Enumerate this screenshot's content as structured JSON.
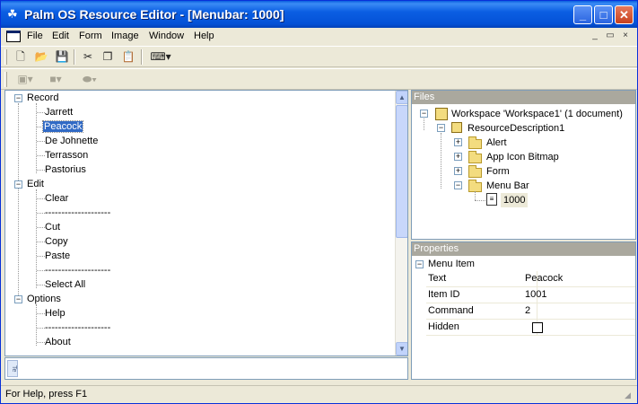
{
  "window": {
    "title": "Palm OS Resource Editor - [Menubar: 1000]",
    "minimize": "_",
    "maximize": "□",
    "close": "✕"
  },
  "menubar": {
    "items": [
      "File",
      "Edit",
      "Form",
      "Image",
      "Window",
      "Help"
    ],
    "mdi": [
      "_",
      "▭",
      "×"
    ]
  },
  "toolbar": {
    "icons": [
      "new-file-icon",
      "open-folder-icon",
      "save-icon",
      "cut-icon",
      "copy-icon",
      "paste-icon",
      "keyboard-icon"
    ]
  },
  "tree": {
    "groups": [
      {
        "label": "Record",
        "items": [
          "Jarrett",
          "Peacock",
          "De Johnette",
          "Terrasson",
          "Pastorius"
        ]
      },
      {
        "label": "Edit",
        "items": [
          "Clear",
          "--------------------",
          "Cut",
          "Copy",
          "Paste",
          "--------------------",
          "Select All"
        ]
      },
      {
        "label": "Options",
        "items": [
          "Help",
          "--------------------",
          "About"
        ]
      }
    ],
    "selected": "Peacock"
  },
  "bottom_tab": "Te",
  "files": {
    "header": "Files",
    "workspace": "Workspace 'Workspace1' (1 document)",
    "resource": "ResourceDescription1",
    "folders": [
      "Alert",
      "App Icon Bitmap",
      "Form",
      "Menu Bar"
    ],
    "menubar_child": "1000"
  },
  "properties": {
    "header": "Properties",
    "section": "Menu Item",
    "rows": [
      {
        "name": "Text",
        "value": "Peacock"
      },
      {
        "name": "Item ID",
        "value": "1001"
      },
      {
        "name": "Command",
        "value": "2"
      },
      {
        "name": "Hidden",
        "value": ""
      }
    ]
  },
  "status": {
    "text": "For Help, press F1"
  }
}
